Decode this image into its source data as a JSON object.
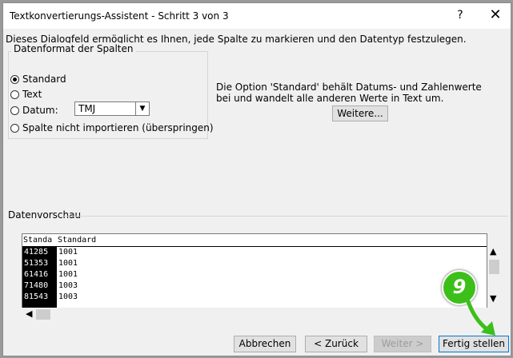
{
  "window": {
    "title": "Textkonvertierungs-Assistent - Schritt 3 von 3",
    "help_label": "?",
    "close_label": "✕"
  },
  "intro": "Dieses Dialogfeld ermöglicht es Ihnen, jede Spalte zu markieren und den Datentyp festzulegen.",
  "format_group": {
    "title": "Datenformat der Spalten",
    "options": [
      {
        "label": "Standard",
        "checked": true
      },
      {
        "label": "Text",
        "checked": false
      },
      {
        "label": "Datum:",
        "checked": false
      },
      {
        "label": "Spalte nicht importieren (überspringen)",
        "checked": false
      }
    ],
    "date_select_value": "TMJ"
  },
  "description": "Die Option 'Standard' behält Datums- und Zahlenwerte bei und wandelt alle anderen Werte in Text um.",
  "more_button": "Weitere...",
  "preview": {
    "label": "Datenvorschau",
    "headers": [
      "Standa",
      "Standard"
    ],
    "rows": [
      [
        "41285",
        "1001"
      ],
      [
        "51353",
        "1001"
      ],
      [
        "61416",
        "1001"
      ],
      [
        "71480",
        "1003"
      ],
      [
        "81543",
        "1003"
      ]
    ]
  },
  "buttons": {
    "cancel": "Abbrechen",
    "back": "< Zurück",
    "next": "Weiter >",
    "finish": "Fertig stellen"
  },
  "overlay_badge": "9",
  "colors": {
    "badge": "#3dbf1a",
    "selected_column": "#000000",
    "accent": "#0078d7"
  }
}
